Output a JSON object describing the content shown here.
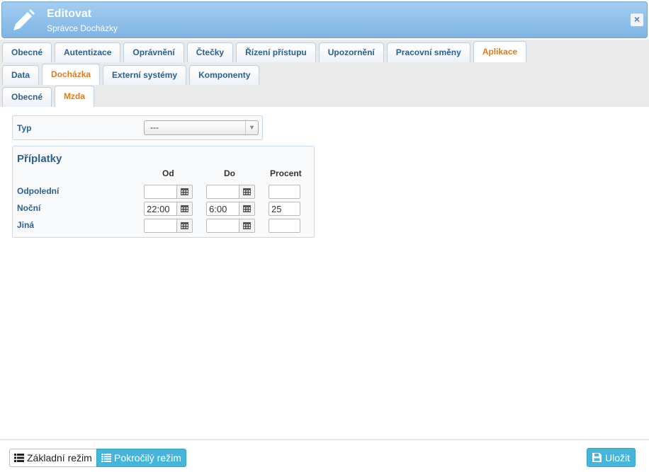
{
  "header": {
    "title": "Editovat",
    "subtitle": "Správce Docházky",
    "close_label": "×",
    "icon": "pencil-icon"
  },
  "tabs_main": [
    "Obecné",
    "Autentizace",
    "Oprávnění",
    "Čtečky",
    "Řízení přístupu",
    "Upozornění",
    "Pracovní směny",
    "Aplikace"
  ],
  "tabs_main_active": "Aplikace",
  "tabs_app": [
    "Data",
    "Docházka",
    "Externí systémy",
    "Komponenty"
  ],
  "tabs_app_active": "Docházka",
  "tabs_attendance": [
    "Obecné",
    "Mzda"
  ],
  "tabs_attendance_active": "Mzda",
  "typ": {
    "label": "Typ",
    "value": "---"
  },
  "priplatky": {
    "title": "Příplatky",
    "col_od": "Od",
    "col_do": "Do",
    "col_procent": "Procent",
    "rows": [
      {
        "label": "Odpolední",
        "od": "",
        "do": "",
        "procent": ""
      },
      {
        "label": "Noční",
        "od": "22:00",
        "do": "6:00",
        "procent": "25"
      },
      {
        "label": "Jiná",
        "od": "",
        "do": "",
        "procent": ""
      }
    ]
  },
  "footer": {
    "basic_mode": "Základní režim",
    "advanced_mode": "Pokročilý režim",
    "save": "Uložit"
  },
  "colors": {
    "accent_blue": "#45b6d9",
    "tab_text": "#2d5f8f",
    "active_tab": "#e07b1a"
  }
}
